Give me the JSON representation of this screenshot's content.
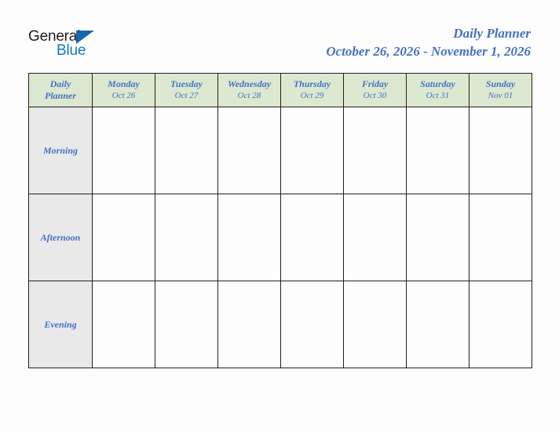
{
  "logo": {
    "text_primary": "General",
    "text_secondary": "Blue",
    "triangle_icon": "triangle-icon",
    "color_primary": "#231f20",
    "color_secondary": "#1479bf"
  },
  "header": {
    "title": "Daily Planner",
    "subtitle": "October 26, 2026 - November 1, 2026",
    "accent_color": "#4472c4"
  },
  "planner": {
    "corner": {
      "line1": "Daily",
      "line2": "Planner"
    },
    "header_bg": "#dce8d0",
    "row_label_bg": "#e9e9e9",
    "border_color": "#231f20",
    "days": [
      {
        "name": "Monday",
        "date": "Oct 26"
      },
      {
        "name": "Tuesday",
        "date": "Oct 27"
      },
      {
        "name": "Wednesday",
        "date": "Oct 28"
      },
      {
        "name": "Thursday",
        "date": "Oct 29"
      },
      {
        "name": "Friday",
        "date": "Oct 30"
      },
      {
        "name": "Saturday",
        "date": "Oct 31"
      },
      {
        "name": "Sunday",
        "date": "Nov 01"
      }
    ],
    "rows": [
      {
        "label": "Morning",
        "cells": [
          "",
          "",
          "",
          "",
          "",
          "",
          ""
        ]
      },
      {
        "label": "Afternoon",
        "cells": [
          "",
          "",
          "",
          "",
          "",
          "",
          ""
        ]
      },
      {
        "label": "Evening",
        "cells": [
          "",
          "",
          "",
          "",
          "",
          "",
          ""
        ]
      }
    ]
  }
}
